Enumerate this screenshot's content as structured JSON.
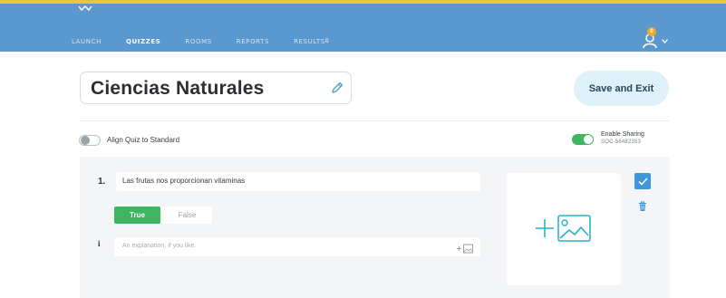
{
  "nav": {
    "items": [
      {
        "label": "LAUNCH",
        "active": false
      },
      {
        "label": "QUIZZES",
        "active": true
      },
      {
        "label": "ROOMS",
        "active": false
      },
      {
        "label": "REPORTS",
        "active": false
      },
      {
        "label": "RESULTS",
        "active": false,
        "sup": "β"
      }
    ],
    "user_badge": "0",
    "user_icon": "user-icon",
    "colors": {
      "bar": "#5b98ce",
      "top_border": "#e0c93a",
      "badge": "#f3a81f"
    }
  },
  "quiz": {
    "title": "Ciencias Naturales",
    "save_label": "Save and Exit",
    "align_label": "Align Quiz to Standard",
    "sharing_label": "Enable Sharing",
    "sharing_code": "SOC-56482353",
    "sharing_enabled": true,
    "align_enabled": false
  },
  "question": {
    "number": "1.",
    "text": "Las frutas nos proporcionan vitaminas",
    "true_label": "True",
    "false_label": "False",
    "selected": "True",
    "info_glyph": "i",
    "explanation_placeholder": "An explanation, if you like.",
    "explanation_media": "+⊟"
  },
  "colors": {
    "accent_green": "#3fb562",
    "accent_blue": "#3d97d8",
    "image_icon": "#2fb0c8"
  }
}
